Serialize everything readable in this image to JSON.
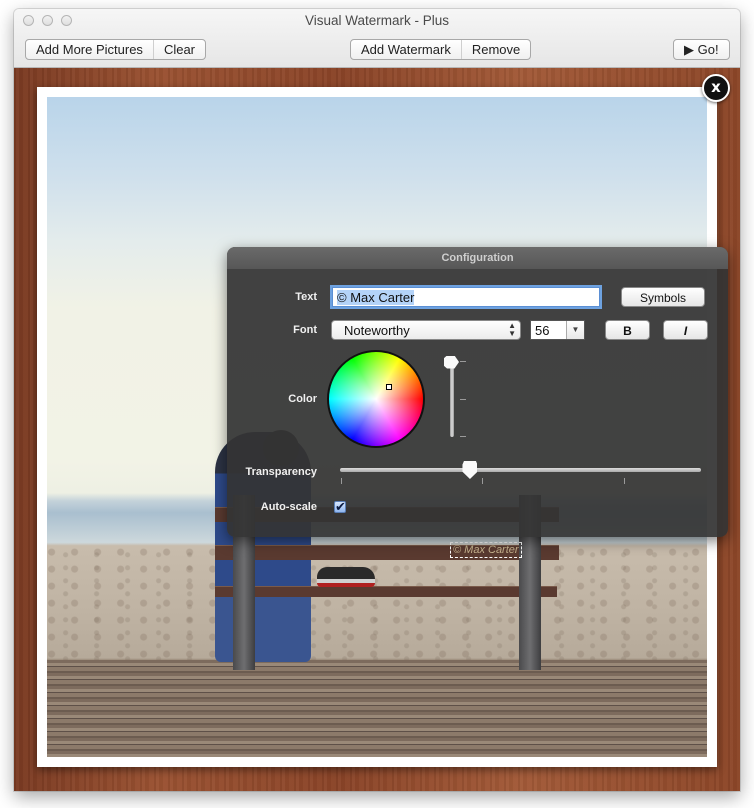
{
  "window": {
    "title": "Visual Watermark - Plus"
  },
  "toolbar": {
    "add_more_pictures": "Add More Pictures",
    "clear": "Clear",
    "add_watermark": "Add Watermark",
    "remove": "Remove",
    "go": "▶ Go!"
  },
  "preview": {
    "close_icon_glyph": "x",
    "watermark_text": "© Max Carter"
  },
  "config": {
    "title": "Configuration",
    "text_label": "Text",
    "text_value": "© Max Carter",
    "symbols_button": "Symbols",
    "font_label": "Font",
    "font_value": "Noteworthy",
    "font_size": "56",
    "bold_button": "B",
    "italic_button": "I",
    "color_label": "Color",
    "brightness_level": 1.0,
    "transparency_label": "Transparency",
    "transparency_value": 0.36,
    "autoscale_label": "Auto-scale",
    "autoscale_checked": true,
    "checkmark_glyph": "✔",
    "select_arrows_glyph": "▲▼",
    "combo_arrow_glyph": "▼"
  }
}
